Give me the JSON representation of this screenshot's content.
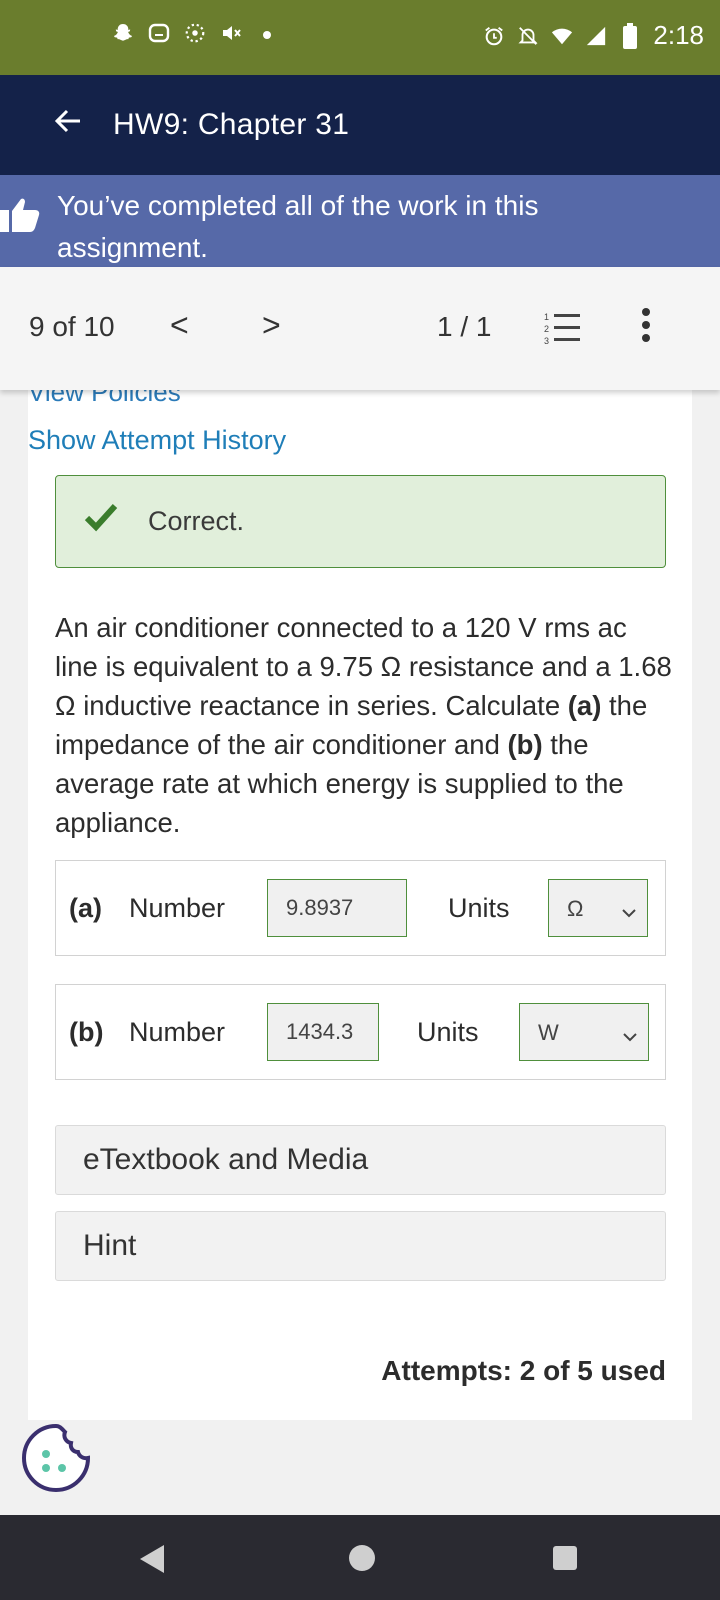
{
  "status_bar": {
    "left_icons": [
      "snapchat-icon",
      "chat-icon",
      "dotted-circle-icon",
      "muted-icon",
      "dot-icon"
    ],
    "right_icons": [
      "alarm-icon",
      "notifications-off-icon",
      "wifi-icon",
      "signal-icon",
      "battery-icon"
    ],
    "time": "2:18"
  },
  "app_bar": {
    "back_icon": "arrow-left-icon",
    "title": "HW9: Chapter 31"
  },
  "banner": {
    "icon": "thumbs-up-icon",
    "message": "You’ve completed all of the work in this assignment."
  },
  "nav": {
    "position": "9 of 10",
    "prev": "<",
    "next": ">",
    "page": "1 / 1",
    "list_icon": "numbered-list-icon",
    "more_icon": "more-vertical-icon"
  },
  "content": {
    "partial_link": "View Policies",
    "attempt_history_link": "Show Attempt History",
    "result": {
      "icon": "checkmark-icon",
      "text": "Correct."
    },
    "question": {
      "p1": "An air conditioner connected to a 120 V rms ac line is equivalent to a 9.75 Ω resistance and a 1.68 Ω inductive reactance in series. Calculate ",
      "a_tag": "(a)",
      "p2": " the impedance of the air conditioner and ",
      "b_tag": "(b)",
      "p3": " the average rate at which energy is supplied to the appliance."
    },
    "answers": [
      {
        "label": "(a)",
        "number_label": "Number",
        "value": "9.8937",
        "units_label": "Units",
        "unit": "Ω"
      },
      {
        "label": "(b)",
        "number_label": "Number",
        "value": "1434.3",
        "units_label": "Units",
        "unit": "W"
      }
    ],
    "etextbook": "eTextbook and Media",
    "hint": "Hint",
    "attempts": "Attempts: 2 of 5 used"
  },
  "cookie_icon": "cookie-icon",
  "system_nav": {
    "back_icon": "triangle-back-icon",
    "home_icon": "circle-home-icon",
    "recents_icon": "square-recents-icon"
  },
  "colors": {
    "status_bar": "#6a7d2d",
    "app_bar": "#142249",
    "banner": "#5669a8",
    "link": "#1f7eb8",
    "correct_bg": "#e1efdb",
    "correct_border": "#4f8f3c"
  }
}
